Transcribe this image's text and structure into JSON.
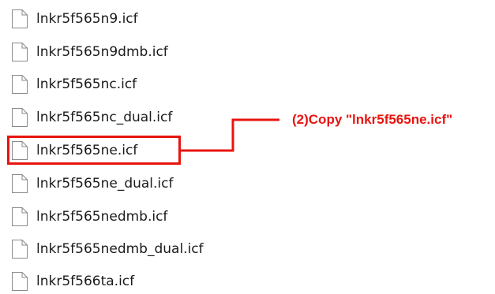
{
  "files": [
    {
      "name": "lnkr5f565n9.icf"
    },
    {
      "name": "lnkr5f565n9dmb.icf"
    },
    {
      "name": "lnkr5f565nc.icf"
    },
    {
      "name": "lnkr5f565nc_dual.icf"
    },
    {
      "name": "lnkr5f565ne.icf",
      "highlighted": true
    },
    {
      "name": "lnkr5f565ne_dual.icf"
    },
    {
      "name": "lnkr5f565nedmb.icf"
    },
    {
      "name": "lnkr5f565nedmb_dual.icf"
    },
    {
      "name": "lnkr5f566ta.icf"
    }
  ],
  "annotation": {
    "text": "(2)Copy \"lnkr5f565ne.icf\"",
    "color": "#e8140f"
  },
  "icons": {
    "file": "file-icon"
  }
}
